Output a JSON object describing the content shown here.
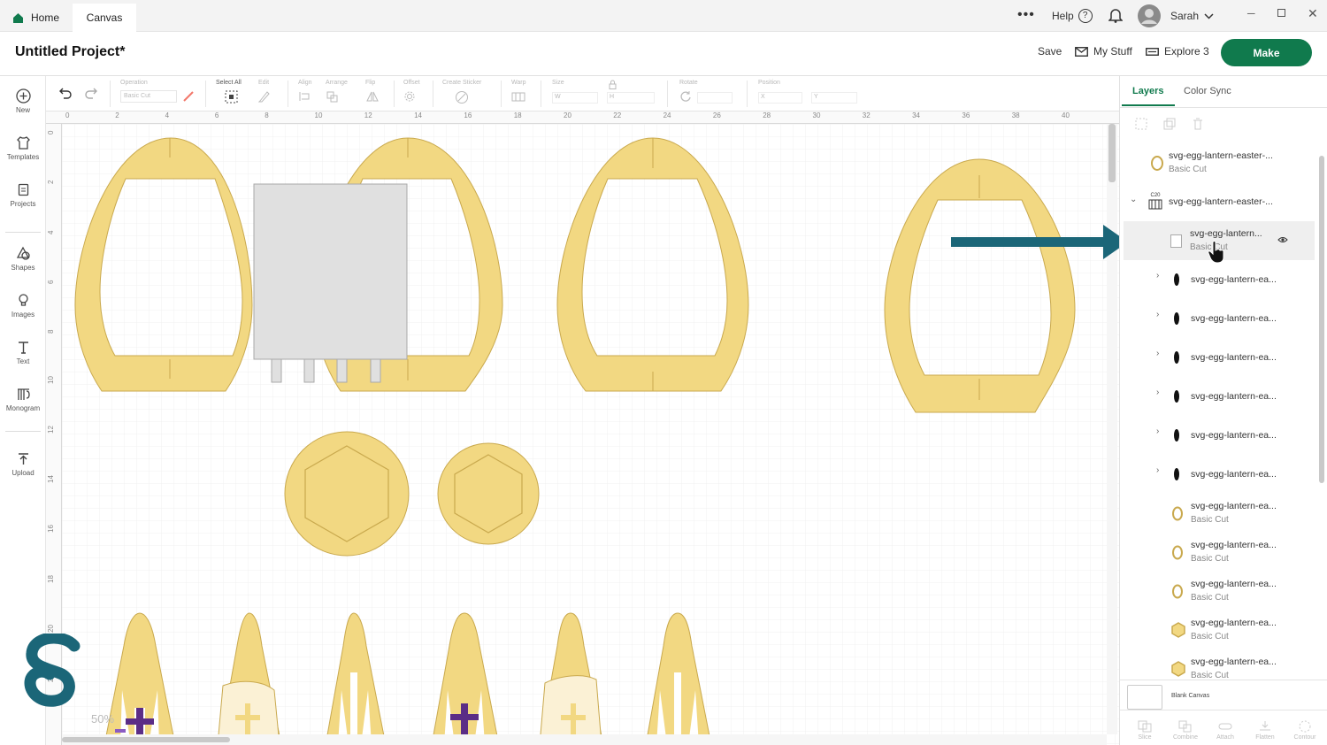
{
  "topbar": {
    "home_label": "Home",
    "canvas_tab_label": "Canvas",
    "help_label": "Help",
    "user_name": "Sarah",
    "help_icon_text": "?"
  },
  "project": {
    "title": "Untitled Project*",
    "save_label": "Save",
    "mystuff_label": "My Stuff",
    "explore_label": "Explore 3",
    "make_label": "Make"
  },
  "leftnav": {
    "items": [
      {
        "label": "New"
      },
      {
        "label": "Templates"
      },
      {
        "label": "Projects"
      },
      {
        "label": "Shapes"
      },
      {
        "label": "Images"
      },
      {
        "label": "Text"
      },
      {
        "label": "Monogram"
      },
      {
        "label": "Upload"
      }
    ]
  },
  "toolbar": {
    "operation_label": "Operation",
    "operation_value": "Basic Cut",
    "select_all_label": "Select All",
    "edit_label": "Edit",
    "align_label": "Align",
    "arrange_label": "Arrange",
    "flip_label": "Flip",
    "offset_label": "Offset",
    "create_sticker_label": "Create Sticker",
    "warp_label": "Warp",
    "size_label": "Size",
    "rotate_label": "Rotate",
    "position_label": "Position",
    "w_label": "W",
    "h_label": "H",
    "x_label": "X",
    "y_label": "Y"
  },
  "ruler": {
    "top_ticks": [
      "0",
      "2",
      "4",
      "6",
      "8",
      "10",
      "12",
      "14",
      "16",
      "18",
      "20",
      "22",
      "24",
      "26",
      "28",
      "30",
      "32",
      "34",
      "36",
      "38",
      "40"
    ],
    "left_ticks": [
      "0",
      "2",
      "4",
      "6",
      "8",
      "10",
      "12",
      "14",
      "16",
      "18",
      "20",
      "22"
    ]
  },
  "canvas": {
    "zoom_label": "50%",
    "colors": {
      "piece_fill": "#f2d882",
      "piece_stroke": "#c9a94e",
      "gray_fill": "#e0e0e0",
      "purple": "#5b2d86"
    }
  },
  "rightpanel": {
    "tab_layers": "Layers",
    "tab_color_sync": "Color Sync",
    "layers": [
      {
        "name": "svg-egg-lantern-easter-...",
        "sub": "Basic Cut",
        "icon": "egg-outline-icon"
      },
      {
        "name": "svg-egg-lantern-easter-...",
        "sub": "",
        "icon": "group-icon",
        "group_badge": "C20"
      },
      {
        "name": "svg-egg-lantern...",
        "sub": "Basic Cut",
        "icon": "blank-square-icon"
      },
      {
        "name": "svg-egg-lantern-ea...",
        "sub": "",
        "icon": "black-drop-icon"
      },
      {
        "name": "svg-egg-lantern-ea...",
        "sub": "",
        "icon": "black-drop-icon"
      },
      {
        "name": "svg-egg-lantern-ea...",
        "sub": "",
        "icon": "black-drop-icon"
      },
      {
        "name": "svg-egg-lantern-ea...",
        "sub": "",
        "icon": "black-drop-icon"
      },
      {
        "name": "svg-egg-lantern-ea...",
        "sub": "",
        "icon": "black-drop-icon"
      },
      {
        "name": "svg-egg-lantern-ea...",
        "sub": "",
        "icon": "black-drop-icon"
      },
      {
        "name": "svg-egg-lantern-ea...",
        "sub": "Basic Cut",
        "icon": "egg-outline-icon"
      },
      {
        "name": "svg-egg-lantern-ea...",
        "sub": "Basic Cut",
        "icon": "egg-outline-icon"
      },
      {
        "name": "svg-egg-lantern-ea...",
        "sub": "Basic Cut",
        "icon": "egg-outline-icon"
      },
      {
        "name": "svg-egg-lantern-ea...",
        "sub": "Basic Cut",
        "icon": "hexagon-icon"
      },
      {
        "name": "svg-egg-lantern-ea...",
        "sub": "Basic Cut",
        "icon": "hexagon-icon"
      }
    ],
    "blank_canvas_label": "Blank Canvas",
    "bottom_actions": [
      {
        "label": "Slice"
      },
      {
        "label": "Combine"
      },
      {
        "label": "Attach"
      },
      {
        "label": "Flatten"
      },
      {
        "label": "Contour"
      }
    ]
  },
  "colors": {
    "accent": "#107a4d",
    "arrow": "#1b6678",
    "logo": "#1b6678"
  }
}
